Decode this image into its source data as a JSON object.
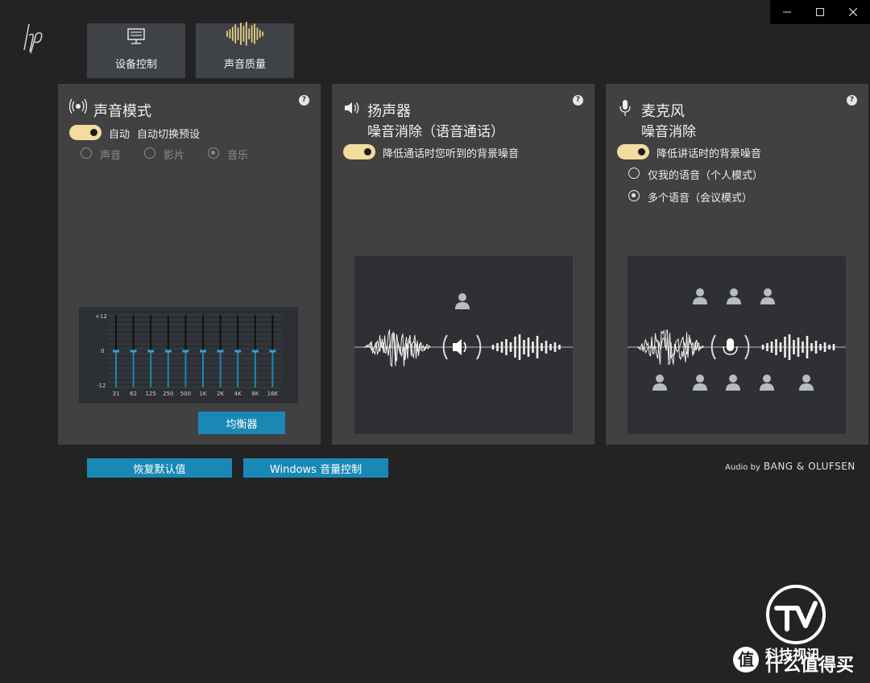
{
  "window": {
    "minimize_icon": "minimize-icon",
    "maximize_icon": "maximize-icon",
    "close_icon": "close-icon"
  },
  "top_tabs": [
    {
      "label": "设备控制",
      "icon": "monitor-icon"
    },
    {
      "label": "声音质量",
      "icon": "waveform-icon"
    }
  ],
  "sound_mode": {
    "title": "声音模式",
    "toggle_on": true,
    "toggle_label": "自动",
    "toggle_desc": "自动切换预设",
    "options": [
      "声音",
      "影片",
      "音乐"
    ],
    "selected": "音乐",
    "equalizer": {
      "y_labels": [
        "+12",
        "0",
        "-12"
      ],
      "bands": [
        "31",
        "62",
        "125",
        "250",
        "500",
        "1K",
        "2K",
        "4K",
        "8K",
        "16K"
      ],
      "gains_db": [
        0,
        0,
        0,
        0,
        0,
        0,
        0,
        0,
        0,
        0
      ]
    },
    "equalizer_button": "均衡器"
  },
  "speaker": {
    "title": "扬声器",
    "subtitle": "噪音消除（语音通话）",
    "toggle_on": true,
    "toggle_label": "降低通话时您听到的背景噪音"
  },
  "microphone": {
    "title": "麦克风",
    "subtitle": "噪音消除",
    "toggle_on": true,
    "toggle_label": "降低讲话时的背景噪音",
    "options": [
      "仅我的语音（个人模式）",
      "多个语音（会议模式）"
    ],
    "selected": "多个语音（会议模式）"
  },
  "help_label": "?",
  "bottom_buttons": {
    "restore": "恢复默认值",
    "windows_volume": "Windows 音量控制"
  },
  "brand": {
    "prefix": "Audio by",
    "name": "BANG & OLUFSEN"
  },
  "watermark": {
    "text": "科技视讯",
    "badge": "值",
    "site": "什么值得买"
  },
  "colors": {
    "accent": "#1a88b4",
    "toggle": "#f2dc9e",
    "panel": "#414141",
    "background": "#232323"
  }
}
